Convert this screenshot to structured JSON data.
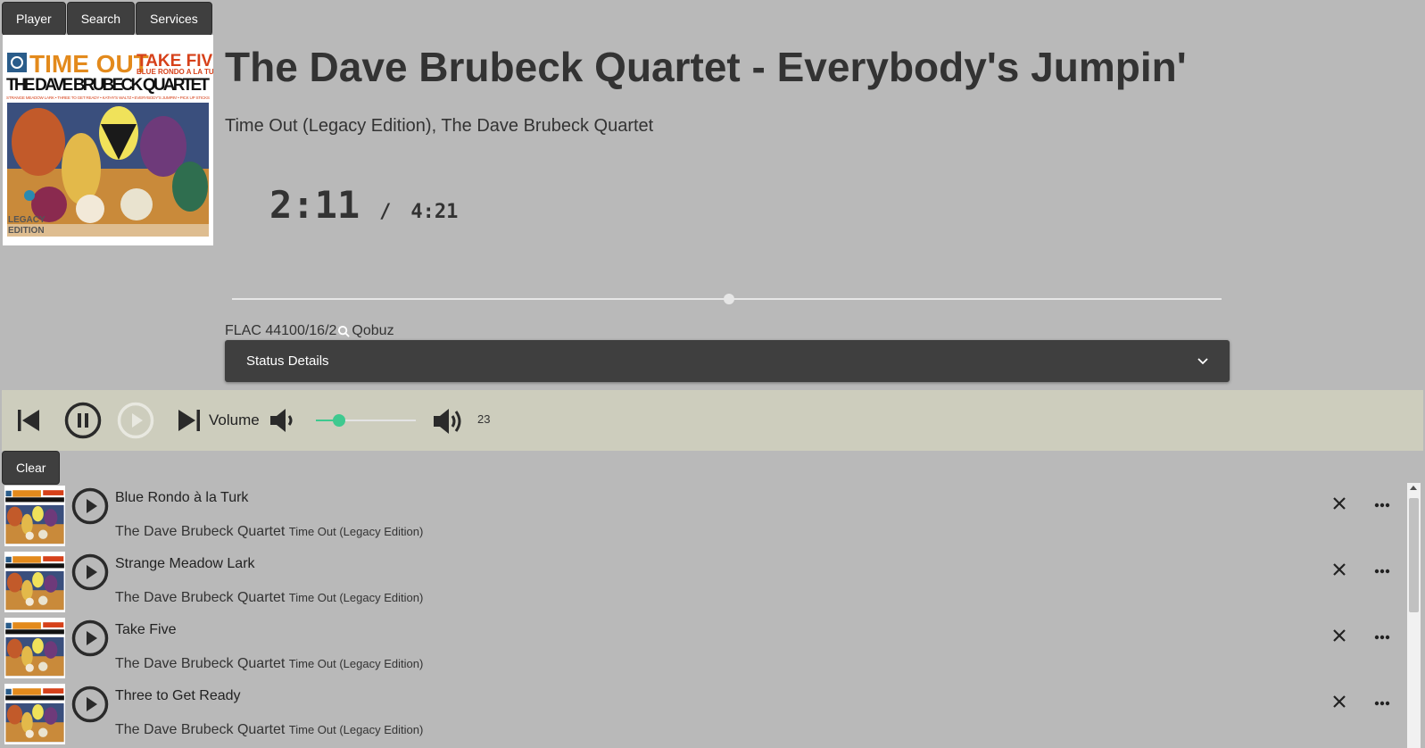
{
  "nav": {
    "tabs": [
      "Player",
      "Search",
      "Services"
    ]
  },
  "now_playing": {
    "title": "The Dave Brubeck Quartet - Everybody's Jumpin'",
    "subtitle": "Time Out (Legacy Edition), The Dave Brubeck Quartet",
    "elapsed": "2:11",
    "separator": "/",
    "duration": "4:21",
    "progress_fraction": 0.502,
    "format": "FLAC 44100/16/2",
    "service": "Qobuz",
    "cover": {
      "heading": "TIME OUT",
      "heading2": "TAKE FIVE",
      "heading3": "BLUE RONDO A LA TURK",
      "band": "THE DAVE BRUBECK QUARTET",
      "tracks_line": "STRANGE MEADOW LARK • THREE TO GET READY • KATHY'S WALTZ • EVERYBODY'S JUMPIN' • PICK UP STICKS",
      "edition_line1": "LEGACY",
      "edition_line2": "EDITION"
    }
  },
  "status": {
    "label": "Status Details"
  },
  "controls": {
    "volume_label": "Volume",
    "volume_value": "23",
    "volume_fraction": 0.23
  },
  "queue": {
    "clear_label": "Clear",
    "items": [
      {
        "title": "Blue Rondo à la Turk",
        "artist": "The Dave Brubeck Quartet",
        "album": "Time Out (Legacy Edition)"
      },
      {
        "title": "Strange Meadow Lark",
        "artist": "The Dave Brubeck Quartet",
        "album": "Time Out (Legacy Edition)"
      },
      {
        "title": "Take Five",
        "artist": "The Dave Brubeck Quartet",
        "album": "Time Out (Legacy Edition)"
      },
      {
        "title": "Three to Get Ready",
        "artist": "The Dave Brubeck Quartet",
        "album": "Time Out (Legacy Edition)"
      }
    ]
  },
  "colors": {
    "background": "#b9b9b9",
    "dark": "#3f3f3f",
    "controls_bg": "#cdcdbd",
    "accent": "#3ec98f"
  }
}
